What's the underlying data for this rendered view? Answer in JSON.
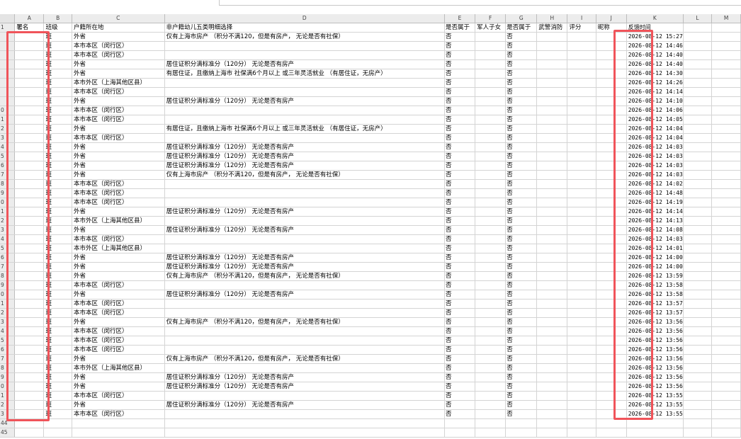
{
  "column_letters": [
    "A",
    "B",
    "C",
    "D",
    "E",
    "F",
    "G",
    "H",
    "I",
    "J",
    "K",
    "L",
    "M"
  ],
  "header_row": {
    "row_no": "1",
    "cells": [
      "署名",
      "班级",
      "户籍所在地",
      "非户籍幼儿五类明细选择",
      "是否属于",
      "军人子女",
      "是否属于",
      "武警消防",
      "评分",
      "昵称",
      "反馈时间",
      "",
      ""
    ]
  },
  "rows": [
    {
      "n": "",
      "cells": [
        "",
        "班",
        "外省",
        "仅有上海市房产 （积分不满120，但是有房产， 无论是否有社保）",
        "否",
        "",
        "否",
        "",
        "",
        "",
        "2026-08-12 15:27",
        "",
        ""
      ]
    },
    {
      "n": "",
      "cells": [
        "",
        "班",
        "本市本区（闵行区）",
        "",
        "否",
        "",
        "否",
        "",
        "",
        "",
        "2026-08-12 14:46",
        "",
        ""
      ]
    },
    {
      "n": "",
      "cells": [
        "",
        "班",
        "本市本区（闵行区）",
        "",
        "否",
        "",
        "否",
        "",
        "",
        "",
        "2026-08-12 14:40",
        "",
        ""
      ]
    },
    {
      "n": "",
      "cells": [
        "",
        "班",
        "外省",
        "居住证积分满标准分（120分） 无论是否有房产",
        "否",
        "",
        "否",
        "",
        "",
        "",
        "2026-08-12 14:40",
        "",
        ""
      ]
    },
    {
      "n": "",
      "cells": [
        "",
        "班",
        "外省",
        "有居住证，且缴纳上海市 社保满6个月以上 或三年灵活就业 （有居住证，无房产）",
        "否",
        "",
        "否",
        "",
        "",
        "",
        "2026-08-12 14:30",
        "",
        ""
      ]
    },
    {
      "n": "",
      "cells": [
        "",
        "班",
        "本市外区（上海其他区县）",
        "",
        "否",
        "",
        "否",
        "",
        "",
        "",
        "2026-08-12 14:26",
        "",
        ""
      ]
    },
    {
      "n": "",
      "cells": [
        "",
        "班",
        "本市本区（闵行区）",
        "",
        "否",
        "",
        "否",
        "",
        "",
        "",
        "2026-08-12 14:14",
        "",
        ""
      ]
    },
    {
      "n": "",
      "cells": [
        "",
        "班",
        "外省",
        "居住证积分满标准分（120分） 无论是否有房产",
        "否",
        "",
        "否",
        "",
        "",
        "",
        "2026-08-12 14:10",
        "",
        ""
      ]
    },
    {
      "n": "0",
      "cells": [
        "",
        "班",
        "本市本区（闵行区）",
        "",
        "否",
        "",
        "否",
        "",
        "",
        "",
        "2026-08-12 14:06",
        "",
        ""
      ]
    },
    {
      "n": "1",
      "cells": [
        "",
        "班",
        "本市本区（闵行区）",
        "",
        "否",
        "",
        "否",
        "",
        "",
        "",
        "2026-08-12 14:05",
        "",
        ""
      ]
    },
    {
      "n": "2",
      "cells": [
        "",
        "班",
        "外省",
        "有居住证，且缴纳上海市 社保满6个月以上 或三年灵活就业 （有居住证，无房产）",
        "否",
        "",
        "否",
        "",
        "",
        "",
        "2026-08-12 14:04",
        "",
        ""
      ]
    },
    {
      "n": "3",
      "cells": [
        "",
        "班",
        "本市本区（闵行区）",
        "",
        "否",
        "",
        "否",
        "",
        "",
        "",
        "2026-08-12 14:04",
        "",
        ""
      ]
    },
    {
      "n": "4",
      "cells": [
        "",
        "班",
        "外省",
        "居住证积分满标准分（120分） 无论是否有房产",
        "否",
        "",
        "否",
        "",
        "",
        "",
        "2026-08-12 14:03",
        "",
        ""
      ]
    },
    {
      "n": "5",
      "cells": [
        "",
        "班",
        "外省",
        "居住证积分满标准分（120分） 无论是否有房产",
        "否",
        "",
        "否",
        "",
        "",
        "",
        "2026-08-12 14:03",
        "",
        ""
      ]
    },
    {
      "n": "6",
      "cells": [
        "",
        "班",
        "外省",
        "居住证积分满标准分（120分） 无论是否有房产",
        "否",
        "",
        "否",
        "",
        "",
        "",
        "2026-08-12 14:03",
        "",
        ""
      ]
    },
    {
      "n": "7",
      "cells": [
        "",
        "班",
        "外省",
        "仅有上海市房产 （积分不满120，但是有房产， 无论是否有社保）",
        "否",
        "",
        "否",
        "",
        "",
        "",
        "2026-08-12 14:03",
        "",
        ""
      ]
    },
    {
      "n": "8",
      "cells": [
        "",
        "班",
        "本市本区（闵行区）",
        "",
        "否",
        "",
        "否",
        "",
        "",
        "",
        "2026-08-12 14:02",
        "",
        ""
      ]
    },
    {
      "n": "9",
      "cells": [
        "",
        "班",
        "本市本区（闵行区）",
        "",
        "否",
        "",
        "否",
        "",
        "",
        "",
        "2026-08-12 14:48",
        "",
        ""
      ]
    },
    {
      "n": "0",
      "cells": [
        "",
        "班",
        "本市本区（闵行区）",
        "",
        "否",
        "",
        "否",
        "",
        "",
        "",
        "2026-08-12 14:19",
        "",
        ""
      ]
    },
    {
      "n": "1",
      "cells": [
        "",
        "班",
        "外省",
        "居住证积分满标准分（120分） 无论是否有房产",
        "否",
        "",
        "否",
        "",
        "",
        "",
        "2026-08-12 14:14",
        "",
        ""
      ]
    },
    {
      "n": "2",
      "cells": [
        "",
        "班",
        "本市外区（上海其他区县）",
        "",
        "否",
        "",
        "否",
        "",
        "",
        "",
        "2026-08-12 14:13",
        "",
        ""
      ]
    },
    {
      "n": "3",
      "cells": [
        "",
        "班",
        "外省",
        "居住证积分满标准分（120分） 无论是否有房产",
        "否",
        "",
        "否",
        "",
        "",
        "",
        "2026-08-12 14:08",
        "",
        ""
      ]
    },
    {
      "n": "4",
      "cells": [
        "",
        "班",
        "本市本区（闵行区）",
        "",
        "否",
        "",
        "否",
        "",
        "",
        "",
        "2026-08-12 14:03",
        "",
        ""
      ]
    },
    {
      "n": "5",
      "cells": [
        "",
        "班",
        "本市外区（上海其他区县）",
        "",
        "否",
        "",
        "否",
        "",
        "",
        "",
        "2026-08-12 14:01",
        "",
        ""
      ]
    },
    {
      "n": "6",
      "cells": [
        "",
        "班",
        "外省",
        "居住证积分满标准分（120分） 无论是否有房产",
        "否",
        "",
        "否",
        "",
        "",
        "",
        "2026-08-12 14:00",
        "",
        ""
      ]
    },
    {
      "n": "7",
      "cells": [
        "",
        "班",
        "外省",
        "居住证积分满标准分（120分） 无论是否有房产",
        "否",
        "",
        "否",
        "",
        "",
        "",
        "2026-08-12 14:00",
        "",
        ""
      ]
    },
    {
      "n": "8",
      "cells": [
        "",
        "班",
        "外省",
        "仅有上海市房产 （积分不满120，但是有房产， 无论是否有社保）",
        "否",
        "",
        "否",
        "",
        "",
        "",
        "2026-08-12 13:59",
        "",
        ""
      ]
    },
    {
      "n": "9",
      "cells": [
        "",
        "班",
        "本市本区（闵行区）",
        "",
        "否",
        "",
        "否",
        "",
        "",
        "",
        "2026-08-12 13:58",
        "",
        ""
      ]
    },
    {
      "n": "0",
      "cells": [
        "",
        "班",
        "外省",
        "居住证积分满标准分（120分） 无论是否有房产",
        "否",
        "",
        "否",
        "",
        "",
        "",
        "2026-08-12 13:58",
        "",
        ""
      ]
    },
    {
      "n": "1",
      "cells": [
        "",
        "班",
        "本市本区（闵行区）",
        "",
        "否",
        "",
        "否",
        "",
        "",
        "",
        "2026-08-12 13:57",
        "",
        ""
      ]
    },
    {
      "n": "2",
      "cells": [
        "",
        "班",
        "本市本区（闵行区）",
        "",
        "否",
        "",
        "否",
        "",
        "",
        "",
        "2026-08-12 13:57",
        "",
        ""
      ]
    },
    {
      "n": "3",
      "cells": [
        "",
        "班",
        "外省",
        "仅有上海市房产 （积分不满120，但是有房产， 无论是否有社保）",
        "否",
        "",
        "否",
        "",
        "",
        "",
        "2026-08-12 13:56",
        "",
        ""
      ]
    },
    {
      "n": "4",
      "cells": [
        "",
        "班",
        "本市本区（闵行区）",
        "",
        "否",
        "",
        "否",
        "",
        "",
        "",
        "2026-08-12 13:56",
        "",
        ""
      ]
    },
    {
      "n": "5",
      "cells": [
        "",
        "班",
        "本市本区（闵行区）",
        "",
        "否",
        "",
        "否",
        "",
        "",
        "",
        "2026-08-12 13:56",
        "",
        ""
      ]
    },
    {
      "n": "6",
      "cells": [
        "",
        "班",
        "本市本区（闵行区）",
        "",
        "否",
        "",
        "否",
        "",
        "",
        "",
        "2026-08-12 13:56",
        "",
        ""
      ]
    },
    {
      "n": "7",
      "cells": [
        "",
        "班",
        "外省",
        "仅有上海市房产 （积分不满120，但是有房产， 无论是否有社保）",
        "否",
        "",
        "否",
        "",
        "",
        "",
        "2026-08-12 13:56",
        "",
        ""
      ]
    },
    {
      "n": "8",
      "cells": [
        "",
        "班",
        "本市外区（上海其他区县）",
        "",
        "否",
        "",
        "否",
        "",
        "",
        "",
        "2026-08-12 13:56",
        "",
        ""
      ]
    },
    {
      "n": "9",
      "cells": [
        "",
        "班",
        "外省",
        "居住证积分满标准分（120分） 无论是否有房产",
        "否",
        "",
        "否",
        "",
        "",
        "",
        "2026-08-12 13:56",
        "",
        ""
      ]
    },
    {
      "n": "0",
      "cells": [
        "",
        "班",
        "外省",
        "居住证积分满标准分（120分） 无论是否有房产",
        "否",
        "",
        "否",
        "",
        "",
        "",
        "2026-08-12 13:56",
        "",
        ""
      ]
    },
    {
      "n": "1",
      "cells": [
        "",
        "班",
        "本市本区（闵行区）",
        "",
        "否",
        "",
        "否",
        "",
        "",
        "",
        "2026-08-12 13:55",
        "",
        ""
      ]
    },
    {
      "n": "2",
      "cells": [
        "",
        "班",
        "外省",
        "居住证积分满标准分（120分） 无论是否有房产",
        "否",
        "",
        "否",
        "",
        "",
        "",
        "2026-08-12 13:55",
        "",
        ""
      ]
    },
    {
      "n": "3",
      "cells": [
        "",
        "班",
        "本市本区（闵行区）",
        "",
        "否",
        "",
        "否",
        "",
        "",
        "",
        "2026-08-12 13:55",
        "",
        ""
      ]
    },
    {
      "n": "44",
      "cells": [
        "",
        "",
        "",
        "",
        "",
        "",
        "",
        "",
        "",
        "",
        "",
        "",
        ""
      ]
    },
    {
      "n": "45",
      "cells": [
        "",
        "",
        "",
        "",
        "",
        "",
        "",
        "",
        "",
        "",
        "",
        "",
        ""
      ]
    }
  ],
  "colors": {
    "highlight": "#f0545a",
    "header_bg": "#ececec",
    "grid": "#d4d4d4"
  }
}
